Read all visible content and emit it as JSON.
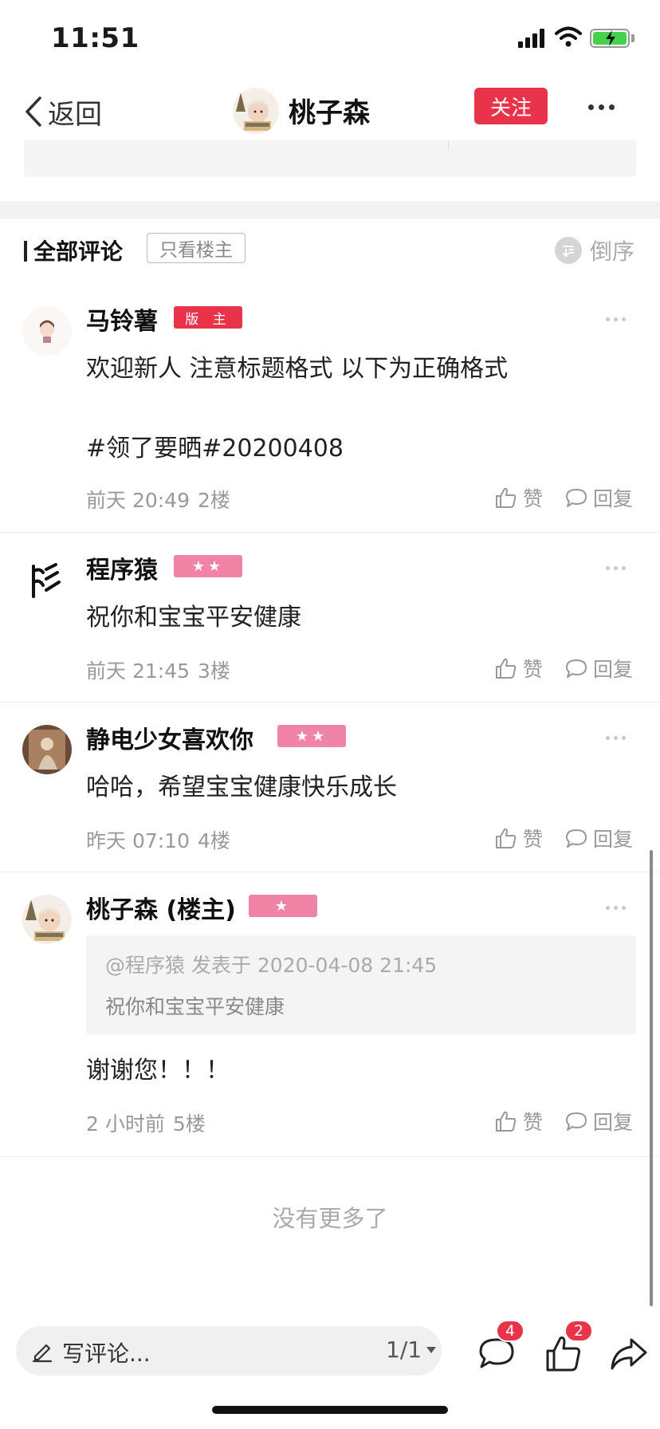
{
  "status_bar": {
    "time": "11:51"
  },
  "nav": {
    "back_label": "返回",
    "title": "桃子森",
    "follow_label": "关注"
  },
  "comments_header": {
    "title": "全部评论",
    "only_op_label": "只看楼主",
    "sort_label": "倒序"
  },
  "comments": [
    {
      "name": "马铃薯",
      "badge": "版 主",
      "text": "欢迎新人 注意标题格式 以下为正确格式\n\n#领了要晒#20200408",
      "time": "前天 20:49",
      "floor": "2楼",
      "like_label": "赞",
      "reply_label": "回复"
    },
    {
      "name": "程序猿",
      "badge": "★★",
      "text": "祝你和宝宝平安健康",
      "time": "前天 21:45",
      "floor": "3楼",
      "like_label": "赞",
      "reply_label": "回复"
    },
    {
      "name": "静电少女喜欢你",
      "badge": "★★",
      "text": "哈哈，希望宝宝健康快乐成长",
      "time": "昨天 07:10",
      "floor": "4楼",
      "like_label": "赞",
      "reply_label": "回复"
    },
    {
      "name": "桃子森 (楼主)",
      "badge": "★",
      "quote_header": "@程序猿 发表于 2020-04-08 21:45",
      "quote_text": "祝你和宝宝平安健康",
      "text": "谢谢您！！！",
      "time": "2 小时前",
      "floor": "5楼",
      "like_label": "赞",
      "reply_label": "回复"
    }
  ],
  "no_more_text": "没有更多了",
  "bottom_bar": {
    "input_label": "写评论...",
    "page_indicator": "1/1",
    "comment_count": "4",
    "like_count": "2"
  },
  "colors": {
    "accent": "#e8334a",
    "badge_pink": "#f084a6",
    "battery_green": "#44d34a"
  }
}
